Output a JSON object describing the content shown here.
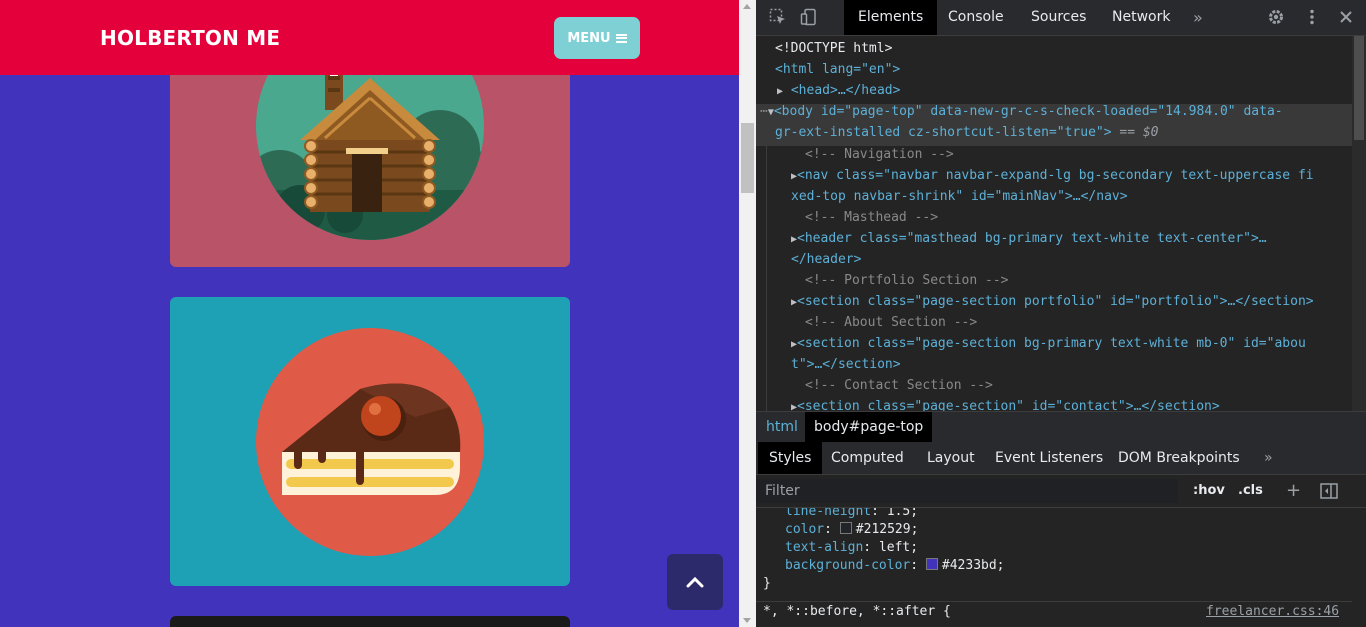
{
  "site": {
    "brand": "HOLBERTON ME",
    "menu_label": "MENU",
    "colors": {
      "page_background": "#4233bd",
      "navbar": "#e3003b",
      "menu_button": "#7fd0d4",
      "cabin_card": "#b95368",
      "cake_card": "#1ea0b5",
      "scroll_top_button": "#2d2a6b"
    },
    "portfolio_items": [
      {
        "icon": "cabin-icon"
      },
      {
        "icon": "cake-icon"
      },
      {
        "icon": "dark-card"
      }
    ],
    "scroll_top_icon": "chevron-up-icon"
  },
  "devtools": {
    "tools": [
      "inspect-element-icon",
      "device-toolbar-icon"
    ],
    "tabs": [
      "Elements",
      "Console",
      "Sources",
      "Network"
    ],
    "active_tab": "Elements",
    "more_tabs": "»",
    "settings_icon": "gear-icon",
    "menu_icon": "vertical-dots-icon",
    "close_icon": "close-icon",
    "dom": {
      "doctype": "<!DOCTYPE html>",
      "html_open": "<html lang=\"en\">",
      "head": "<head>…</head>",
      "body_line1": "<body id=\"page-top\" data-new-gr-c-s-check-loaded=\"14.984.0\" data-",
      "body_line2": "gr-ext-installed cz-shortcut-listen=\"true\">",
      "body_eq": " == $0",
      "comment_nav": "<!-- Navigation -->",
      "nav_line1": "<nav class=\"navbar navbar-expand-lg bg-secondary text-uppercase fi",
      "nav_line2": "xed-top navbar-shrink\" id=\"mainNav\">…</nav>",
      "comment_masthead": "<!-- Masthead -->",
      "header_line1": "<header class=\"masthead bg-primary text-white text-center\">…",
      "header_line2": "</header>",
      "comment_portfolio": "<!-- Portfolio Section -->",
      "section_portfolio": "<section class=\"page-section portfolio\" id=\"portfolio\">…</section>",
      "comment_about": "<!-- About Section -->",
      "section_about_line1": "<section class=\"page-section bg-primary text-white mb-0\" id=\"abou",
      "section_about_line2": "t\">…</section>",
      "comment_contact": "<!-- Contact Section -->",
      "section_contact": "<section class=\"page-section\" id=\"contact\">…</section>"
    },
    "breadcrumbs": [
      "html",
      "body#page-top"
    ],
    "sub_tabs": [
      "Styles",
      "Computed",
      "Layout",
      "Event Listeners",
      "DOM Breakpoints"
    ],
    "active_sub_tab": "Styles",
    "more_sub_tabs": "»",
    "filter_placeholder": "Filter",
    "hov_label": ":hov",
    "cls_label": ".cls",
    "add_rule_icon": "plus-icon",
    "toggle_sidebar_icon": "sidebar-toggle-icon",
    "styles": {
      "lines": [
        {
          "prop": "line-height",
          "value": "1.5;"
        },
        {
          "prop": "color",
          "value": "#212529;",
          "swatch": "#212529"
        },
        {
          "prop": "text-align",
          "value": "left;"
        },
        {
          "prop": "background-color",
          "value": "#4233bd;",
          "swatch": "#4233bd"
        }
      ],
      "closing_brace": "}",
      "next_rule": "*, *::before, *::after {",
      "next_source": "freelancer.css:46"
    }
  }
}
